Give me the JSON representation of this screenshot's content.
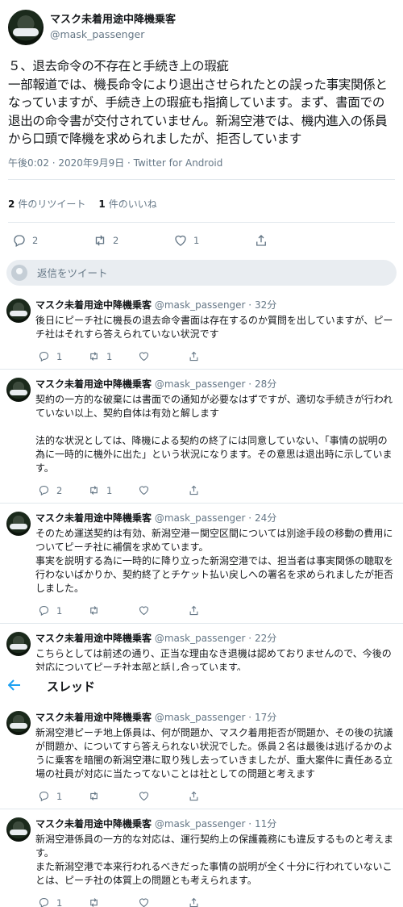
{
  "main_tweet": {
    "display_name": "マスク未着用途中降機乗客",
    "handle": "@mask_passenger",
    "text": "５、退去命令の不存在と手続き上の瑕疵\n一部報道では、機長命令により退出させられたとの誤った事実関係となっていますが、手続き上の瑕疵も指摘しています。まず、書面での退出の命令書が交付されていません。新潟空港では、機内進入の係員から口頭で降機を求められましたが、拒否しています",
    "meta": "午後0:02 · 2020年9月9日 · Twitter for Android",
    "retweets_count": "2",
    "retweets_label": "件のリツイート",
    "likes_count": "1",
    "likes_label": "件のいいね",
    "reply_count": "2",
    "retweet_count": "2",
    "like_count": "1"
  },
  "reply_box": {
    "placeholder": "返信をツイート"
  },
  "thread_bar": {
    "title": "スレッド"
  },
  "replies": [
    {
      "display_name": "マスク未着用途中降機乗客",
      "handle": "@mask_passenger",
      "time": "32分",
      "text": "後日にピーチ社に機長の退去命令書面は存在するのか質問を出していますが、ピーチ社はそれすら答えられていない状況です",
      "reply_count": "1",
      "retweet_count": "1",
      "like_count": ""
    },
    {
      "display_name": "マスク未着用途中降機乗客",
      "handle": "@mask_passenger",
      "time": "28分",
      "text": "契約の一方的な破棄には書面での通知が必要なはずですが、適切な手続きが行われていない以上、契約自体は有効と解します\n\n法的な状況としては、降機による契約の終了には同意していない、「事情の説明の為に一時的に機外に出た」という状況になります。その意思は退出時に示しています。",
      "reply_count": "2",
      "retweet_count": "1",
      "like_count": ""
    },
    {
      "display_name": "マスク未着用途中降機乗客",
      "handle": "@mask_passenger",
      "time": "24分",
      "text": "そのため運送契約は有効、新潟空港ー関空区間については別途手段の移動の費用についてピーチ社に補償を求めています。\n事実を説明する為に一時的に降り立った新潟空港では、担当者は事実関係の聴取を行わないばかりか、契約終了とチケット払い戻しへの署名を求められましたが拒否しました。",
      "reply_count": "1",
      "retweet_count": "",
      "like_count": ""
    },
    {
      "display_name": "マスク未着用途中降機乗客",
      "handle": "@mask_passenger",
      "time": "22分",
      "text": "こちらとしては前述の通り、正当な理由なき退機は認めておりませんので、今後の対応についてピーチ社本部と話し合っています。",
      "reply_count": "",
      "retweet_count": "",
      "like_count": ""
    },
    {
      "display_name": "マスク未着用途中降機乗客",
      "handle": "@mask_passenger",
      "time": "17分",
      "text": "新潟空港ピーチ地上係員は、何が問題か、マスク着用拒否が問題か、その後の抗議が問題か、についてすら答えられない状況でした。係員２名は最後は逃げるかのように乗客を暗闇の新潟空港に取り残し去っていきましたが、重大案件に責任ある立場の社員が対応に当たってないことは社としての問題と考えます",
      "reply_count": "1",
      "retweet_count": "",
      "like_count": ""
    },
    {
      "display_name": "マスク未着用途中降機乗客",
      "handle": "@mask_passenger",
      "time": "11分",
      "text": "新潟空港係員の一方的な対応は、運行契約上の保護義務にも違反するものと考えます。\nまた新潟空港で本来行われるべきだった事情の説明が全く十分に行われていないことは、ピーチ社の体質上の問題とも考えられます。",
      "reply_count": "1",
      "retweet_count": "",
      "like_count": ""
    }
  ],
  "sep": " · "
}
